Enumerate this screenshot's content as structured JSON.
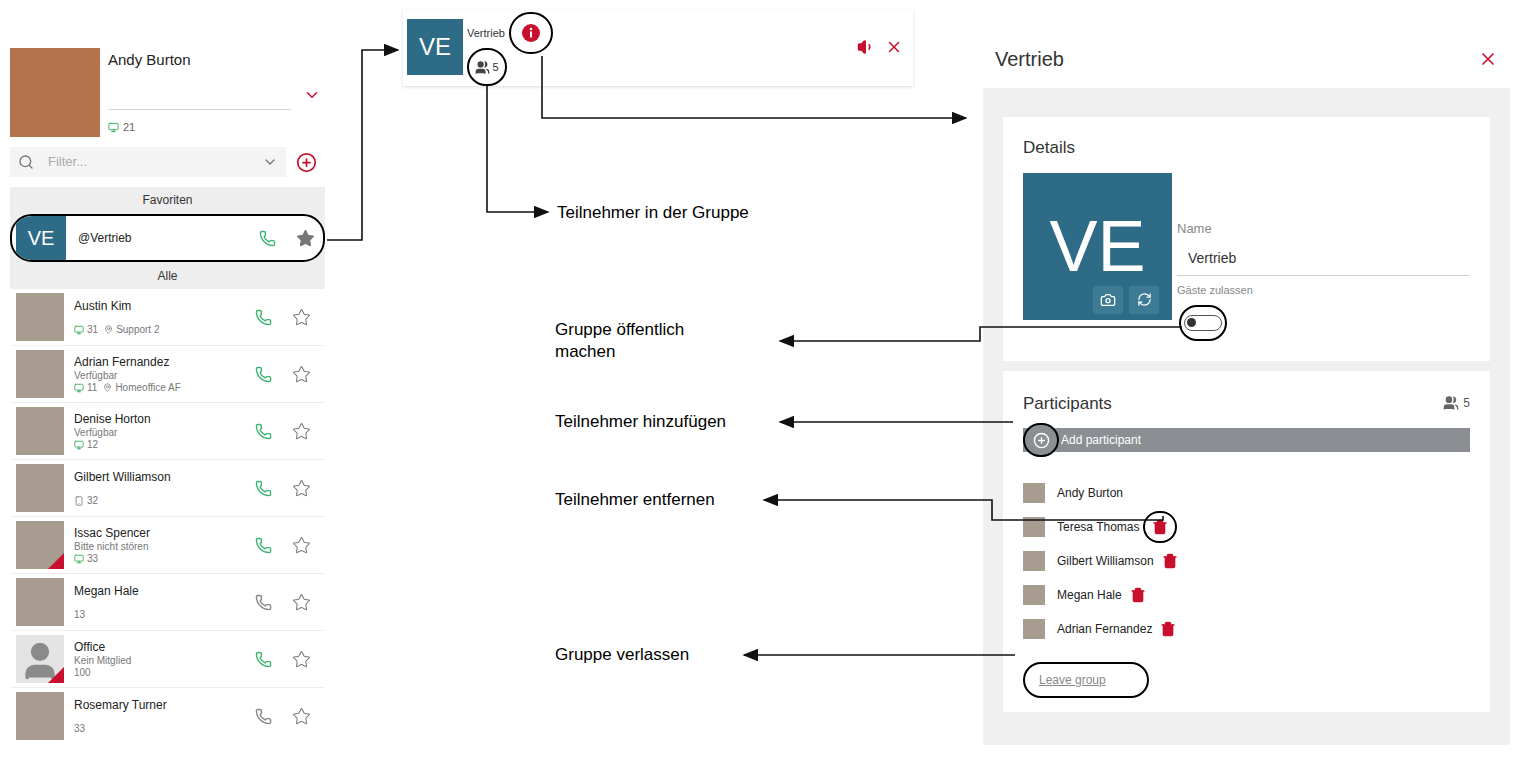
{
  "profile": {
    "name": "Andy Burton",
    "extension": "21"
  },
  "filter": {
    "placeholder": "Filter..."
  },
  "favorites": {
    "header": "Favoriten",
    "items": [
      {
        "avatar": "VE",
        "name": "@Vertrieb",
        "callable": true,
        "starred": true
      }
    ]
  },
  "contacts": {
    "header": "Alle",
    "items": [
      {
        "name": "Austin Kim",
        "status": "",
        "extension": "31",
        "location": "Support 2",
        "device": "desktop",
        "callable": true,
        "starred": false,
        "dnd_badge": false,
        "kind": "photo"
      },
      {
        "name": "Adrian Fernandez",
        "status": "Verfügbar",
        "extension": "11",
        "location": "Homeoffice AF",
        "device": "desktop",
        "callable": true,
        "starred": false,
        "dnd_badge": false,
        "kind": "photo"
      },
      {
        "name": "Denise Horton",
        "status": "Verfügbar",
        "extension": "12",
        "location": "",
        "device": "desktop",
        "callable": true,
        "starred": false,
        "dnd_badge": false,
        "kind": "photo"
      },
      {
        "name": "Gilbert Williamson",
        "status": "",
        "extension": "32",
        "location": "",
        "device": "mobile",
        "callable": true,
        "starred": false,
        "dnd_badge": false,
        "kind": "photo"
      },
      {
        "name": "Issac Spencer",
        "status": "Bitte nicht stören",
        "extension": "33",
        "location": "",
        "device": "desktop",
        "callable": true,
        "starred": false,
        "dnd_badge": true,
        "kind": "photo"
      },
      {
        "name": "Megan Hale",
        "status": "",
        "extension": "13",
        "location": "",
        "device": "none",
        "callable": false,
        "starred": false,
        "dnd_badge": false,
        "kind": "photo"
      },
      {
        "name": "Office",
        "status": "Kein Mitglied",
        "extension": "100",
        "location": "",
        "device": "none",
        "callable": true,
        "starred": false,
        "dnd_badge": true,
        "kind": "placeholder"
      },
      {
        "name": "Rosemary Turner",
        "status": "",
        "extension": "33",
        "location": "",
        "device": "none",
        "callable": false,
        "starred": false,
        "dnd_badge": false,
        "kind": "photo"
      }
    ]
  },
  "chat": {
    "avatar": "VE",
    "title": "Vertrieb",
    "participant_count": "5"
  },
  "panel": {
    "title": "Vertrieb",
    "details_title": "Details",
    "avatar": "VE",
    "name_label": "Name",
    "name_value": "Vertrieb",
    "guests_label": "Gäste zulassen",
    "guests_allowed": false,
    "participants_title": "Participants",
    "participant_count": "5",
    "add_label": "Add participant",
    "participants": [
      {
        "name": "Andy Burton",
        "removable": false
      },
      {
        "name": "Teresa Thomas",
        "removable": true
      },
      {
        "name": "Gilbert Williamson",
        "removable": true
      },
      {
        "name": "Megan Hale",
        "removable": true
      },
      {
        "name": "Adrian Fernandez",
        "removable": true
      }
    ],
    "leave_label": "Leave group"
  },
  "annotations": {
    "participants_in_group": "Teilnehmer in der Gruppe",
    "make_public": "Gruppe öffentlich machen",
    "add_participant": "Teilnehmer hinzufügen",
    "remove_participant": "Teilnehmer entfernen",
    "leave_group": "Gruppe verlassen"
  }
}
